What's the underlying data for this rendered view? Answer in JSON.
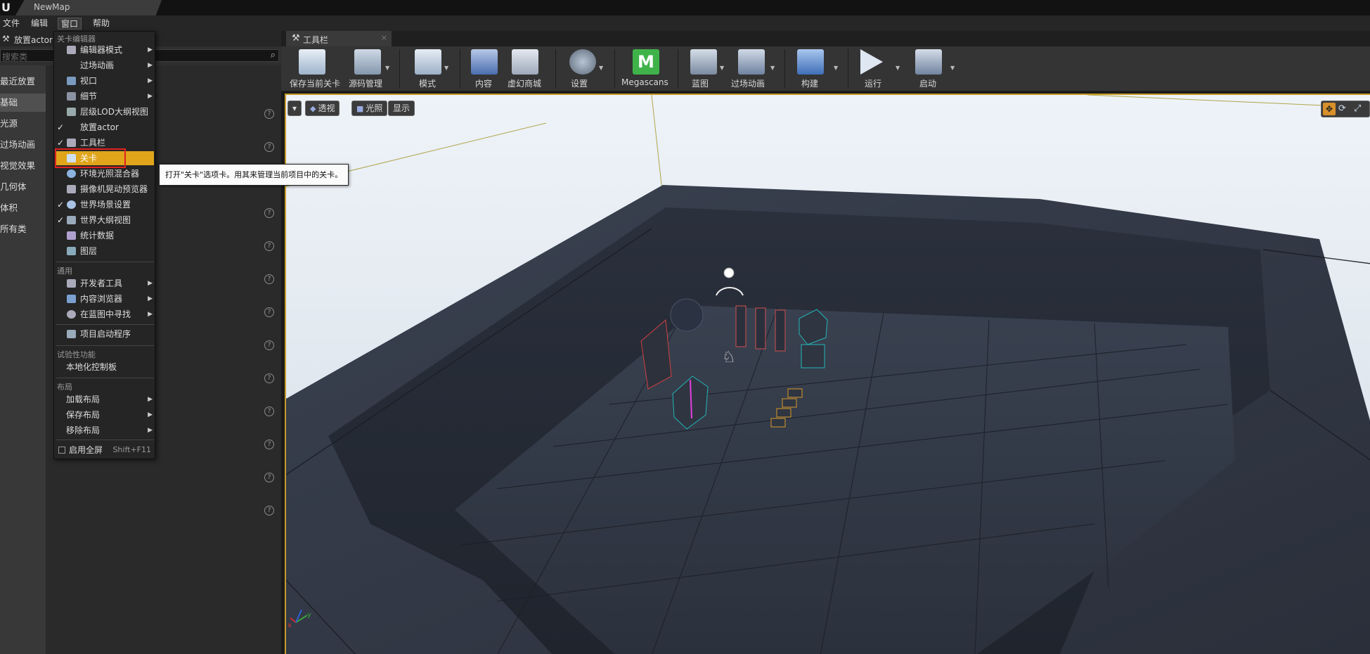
{
  "window": {
    "tab_title": "NewMap",
    "logo_glyph": "U"
  },
  "menubar": [
    "文件",
    "编辑",
    "窗口",
    "帮助"
  ],
  "left_panel": {
    "title": "放置actor",
    "search_placeholder": "搜索类",
    "categories": [
      "最近放置",
      "基础",
      "光源",
      "过场动画",
      "视觉效果",
      "几何体",
      "体积",
      "所有类"
    ],
    "selected_category": "基础"
  },
  "toolbar_tab": {
    "label": "工具栏"
  },
  "toolbar": {
    "buttons": [
      {
        "label": "保存当前关卡",
        "icon": "save-icon"
      },
      {
        "label": "源码管理",
        "icon": "source-control-icon"
      },
      {
        "label": "模式",
        "icon": "modes-icon"
      },
      {
        "label": "内容",
        "icon": "content-icon"
      },
      {
        "label": "虚幻商城",
        "icon": "marketplace-icon"
      },
      {
        "label": "设置",
        "icon": "settings-icon"
      },
      {
        "label": "Megascans",
        "icon": "megascans-icon"
      },
      {
        "label": "蓝图",
        "icon": "blueprint-icon"
      },
      {
        "label": "过场动画",
        "icon": "cinematics-icon"
      },
      {
        "label": "构建",
        "icon": "build-icon"
      },
      {
        "label": "运行",
        "icon": "play-icon"
      },
      {
        "label": "启动",
        "icon": "launch-icon"
      }
    ]
  },
  "viewport": {
    "options_label": "▾",
    "perspective_label": "透视",
    "lit_label": "光照",
    "show_label": "显示",
    "axis_x": "x",
    "axis_y": "y"
  },
  "window_menu": {
    "section_level_editor": "关卡编辑器",
    "items_level_editor": [
      {
        "label": "编辑器模式",
        "checked": false,
        "submenu": true
      },
      {
        "label": "过场动画",
        "checked": false,
        "submenu": true
      },
      {
        "label": "视口",
        "checked": false,
        "submenu": true
      },
      {
        "label": "细节",
        "checked": false,
        "submenu": true
      },
      {
        "label": "层级LOD大纲视图",
        "checked": false,
        "submenu": false
      },
      {
        "label": "放置actor",
        "checked": true,
        "submenu": false
      },
      {
        "label": "工具栏",
        "checked": true,
        "submenu": false
      },
      {
        "label": "关卡",
        "checked": false,
        "submenu": false,
        "highlighted": true
      },
      {
        "label": "环境光照混合器",
        "checked": false,
        "submenu": false
      },
      {
        "label": "摄像机晃动预览器",
        "checked": false,
        "submenu": false
      },
      {
        "label": "世界场景设置",
        "checked": true,
        "submenu": false
      },
      {
        "label": "世界大纲视图",
        "checked": true,
        "submenu": false
      },
      {
        "label": "统计数据",
        "checked": false,
        "submenu": false
      },
      {
        "label": "图层",
        "checked": false,
        "submenu": false
      }
    ],
    "section_general": "通用",
    "items_general": [
      {
        "label": "开发者工具",
        "submenu": true
      },
      {
        "label": "内容浏览器",
        "submenu": true
      },
      {
        "label": "在蓝图中寻找",
        "submenu": true
      },
      {
        "label": "项目启动程序",
        "submenu": false
      }
    ],
    "section_experimental": "试验性功能",
    "items_experimental": [
      {
        "label": "本地化控制板"
      }
    ],
    "section_layout": "布局",
    "items_layout": [
      {
        "label": "加载布局",
        "submenu": true
      },
      {
        "label": "保存布局",
        "submenu": true
      },
      {
        "label": "移除布局",
        "submenu": true
      }
    ],
    "fullscreen": {
      "label": "启用全屏",
      "shortcut": "Shift+F11",
      "checked": false
    }
  },
  "tooltip": {
    "text": "打开\"关卡\"选项卡。用其来管理当前项目中的关卡。"
  },
  "colors": {
    "accent": "#e0a51b",
    "highlight_box": "#e02020",
    "viewport_border": "#c89b28"
  }
}
